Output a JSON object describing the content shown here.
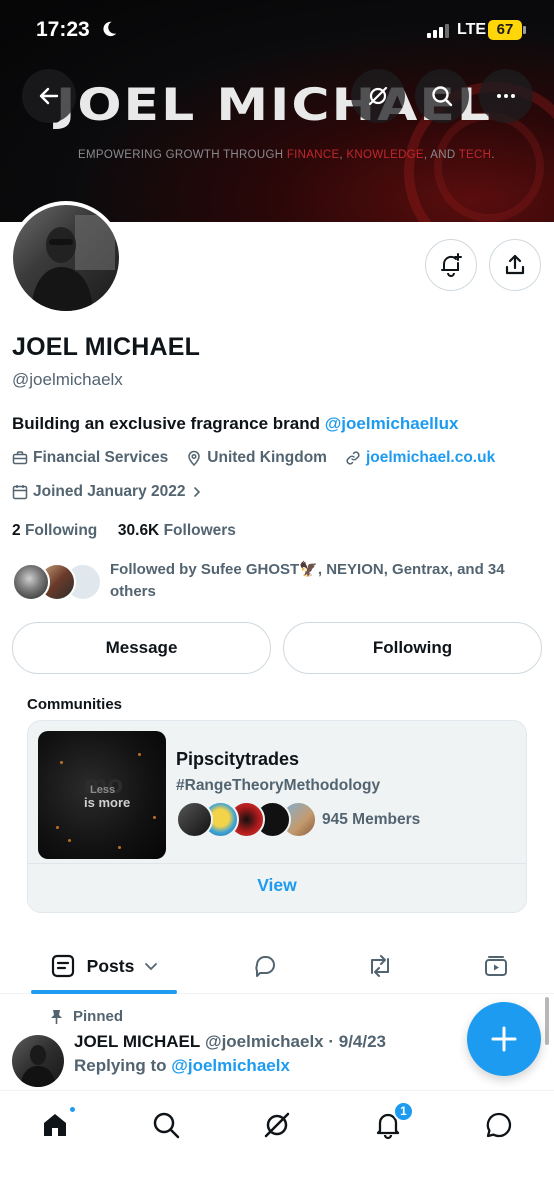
{
  "status_bar": {
    "time": "17:23",
    "network": "LTE",
    "battery": "67"
  },
  "banner": {
    "title": "JOEL MICHAEL",
    "tagline_parts": [
      "EMPOWERING GROWTH THROUGH ",
      "FINANCE",
      ", ",
      "KNOWLEDGE",
      ", AND ",
      "TECH",
      "."
    ],
    "accent_color": "#c0272d"
  },
  "nav": {
    "back_icon": "arrow-left-icon",
    "grok_icon": "grok-icon",
    "search_icon": "search-icon",
    "more_icon": "more-icon"
  },
  "profile": {
    "name": "JOEL MICHAEL",
    "handle": "@joelmichaelx",
    "bio_text": "Building an exclusive fragrance brand ",
    "bio_mention": "@joelmichaellux",
    "category": "Financial Services",
    "location": "United Kingdom",
    "website": "joelmichael.co.uk",
    "joined": "Joined January 2022",
    "following_count": "2",
    "following_label": "Following",
    "followers_count": "30.6K",
    "followers_label": "Followers",
    "followed_by": "Followed by Sufee GHOST🦅, NEYION, Gentrax, and 34 others"
  },
  "actions": {
    "message": "Message",
    "following": "Following"
  },
  "communities": {
    "label": "Communities",
    "card": {
      "name": "Pipscitytrades",
      "tag": "#RangeTheoryMethodology",
      "members": "945 Members",
      "view": "View",
      "thumb_text_top": "mo",
      "thumb_line1": "Less",
      "thumb_line2": "is more"
    }
  },
  "tabs": {
    "posts": "Posts"
  },
  "pinned_tweet": {
    "pinned_label": "Pinned",
    "name": "JOEL MICHAEL",
    "meta": "@joelmichaelx · 9/4/23",
    "replying_prefix": "Replying to ",
    "replying_to": "@joelmichaelx"
  },
  "bottom_nav": {
    "notifications_badge": "1"
  },
  "colors": {
    "primary": "#1d9bf0",
    "text": "#0f1419",
    "secondary": "#536471"
  }
}
